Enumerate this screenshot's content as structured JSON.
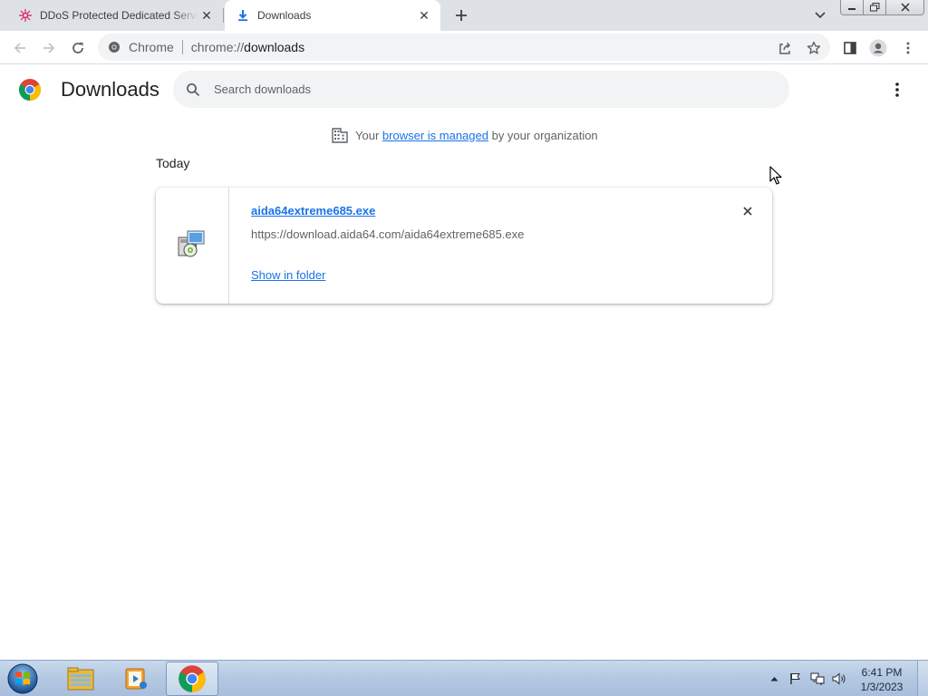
{
  "browser": {
    "tabs": [
      {
        "title": "DDoS Protected Dedicated Servers",
        "icon": "ddos-favicon-icon",
        "active": false
      },
      {
        "title": "Downloads",
        "icon": "download-icon",
        "active": true
      }
    ],
    "omnibox": {
      "chip": "Chrome",
      "url_scheme": "chrome://",
      "url_path": "downloads"
    }
  },
  "downloads_page": {
    "title": "Downloads",
    "search_placeholder": "Search downloads",
    "managed_notice": {
      "prefix": "Your",
      "link": "browser is managed",
      "suffix": "by your organization"
    },
    "sections": [
      {
        "date_label": "Today",
        "items": [
          {
            "file_name": "aida64extreme685.exe",
            "url": "https://download.aida64.com/aida64extreme685.exe",
            "action_label": "Show in folder",
            "icon": "installer-icon"
          }
        ]
      }
    ]
  },
  "taskbar": {
    "apps": [
      "start-orb-icon",
      "explorer-icon",
      "media-player-icon",
      "chrome-icon"
    ],
    "active_app": "chrome-icon",
    "clock_time": "6:41 PM",
    "clock_date": "1/3/2023"
  },
  "colors": {
    "accent": "#1a73e8",
    "tabstrip": "#dee1e6",
    "omnibox": "#f1f3f4"
  }
}
